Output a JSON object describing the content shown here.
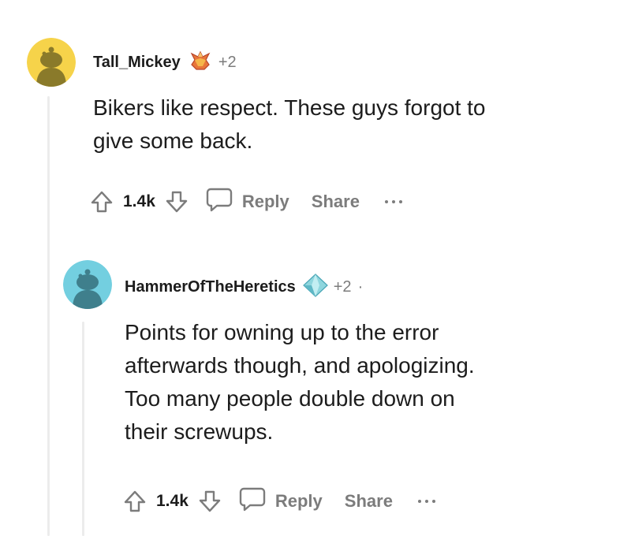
{
  "comments": [
    {
      "username": "Tall_Mickey",
      "award_icon": "crystal-award-icon",
      "award_count": "+2",
      "avatar_color": "#f6d34a",
      "body_lines": [
        "Bikers like respect. These guys forgot to",
        "give some back."
      ],
      "upvotes": "1.4k",
      "reply_label": "Reply",
      "share_label": "Share"
    },
    {
      "username": "HammerOfTheHeretics",
      "award_icon": "diamond-award-icon",
      "award_count": "+2",
      "separator": "·",
      "avatar_color": "#73cfe0",
      "body_lines": [
        "Points for owning up to the error",
        "afterwards though, and apologizing.",
        "Too many people double down on",
        "their screwups."
      ],
      "upvotes": "1.4k",
      "reply_label": "Reply",
      "share_label": "Share"
    }
  ]
}
